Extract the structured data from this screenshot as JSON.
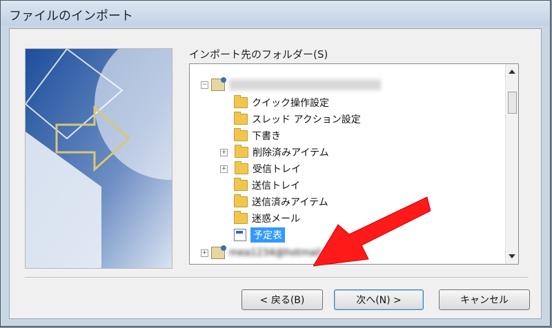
{
  "window": {
    "title": "ファイルのインポート"
  },
  "tree": {
    "label": "インポート先のフォルダー(S)",
    "nodes": [
      {
        "label": "",
        "icon": "account-icon",
        "expander": "−",
        "blurred": true
      },
      {
        "label": "クイック操作設定",
        "icon": "folder-icon",
        "expander": ""
      },
      {
        "label": "スレッド アクション設定",
        "icon": "folder-icon",
        "expander": ""
      },
      {
        "label": "下書き",
        "icon": "folder-icon",
        "expander": ""
      },
      {
        "label": "削除済みアイテム",
        "icon": "folder-icon",
        "expander": "+"
      },
      {
        "label": "受信トレイ",
        "icon": "folder-icon",
        "expander": "+"
      },
      {
        "label": "送信トレイ",
        "icon": "folder-icon",
        "expander": ""
      },
      {
        "label": "送信済みアイテム",
        "icon": "folder-icon",
        "expander": ""
      },
      {
        "label": "迷惑メール",
        "icon": "folder-icon",
        "expander": ""
      },
      {
        "label": "予定表",
        "icon": "calendar-icon",
        "expander": "",
        "selected": true
      },
      {
        "label": "mea1234@hotmail.com",
        "icon": "account-icon",
        "expander": "+",
        "blurred": true
      }
    ]
  },
  "buttons": {
    "back": "< 戻る(B)",
    "next": "次へ(N) >",
    "cancel": "キャンセル"
  },
  "colors": {
    "selection": "#3399ff",
    "annotation_arrow": "#ff0000"
  }
}
